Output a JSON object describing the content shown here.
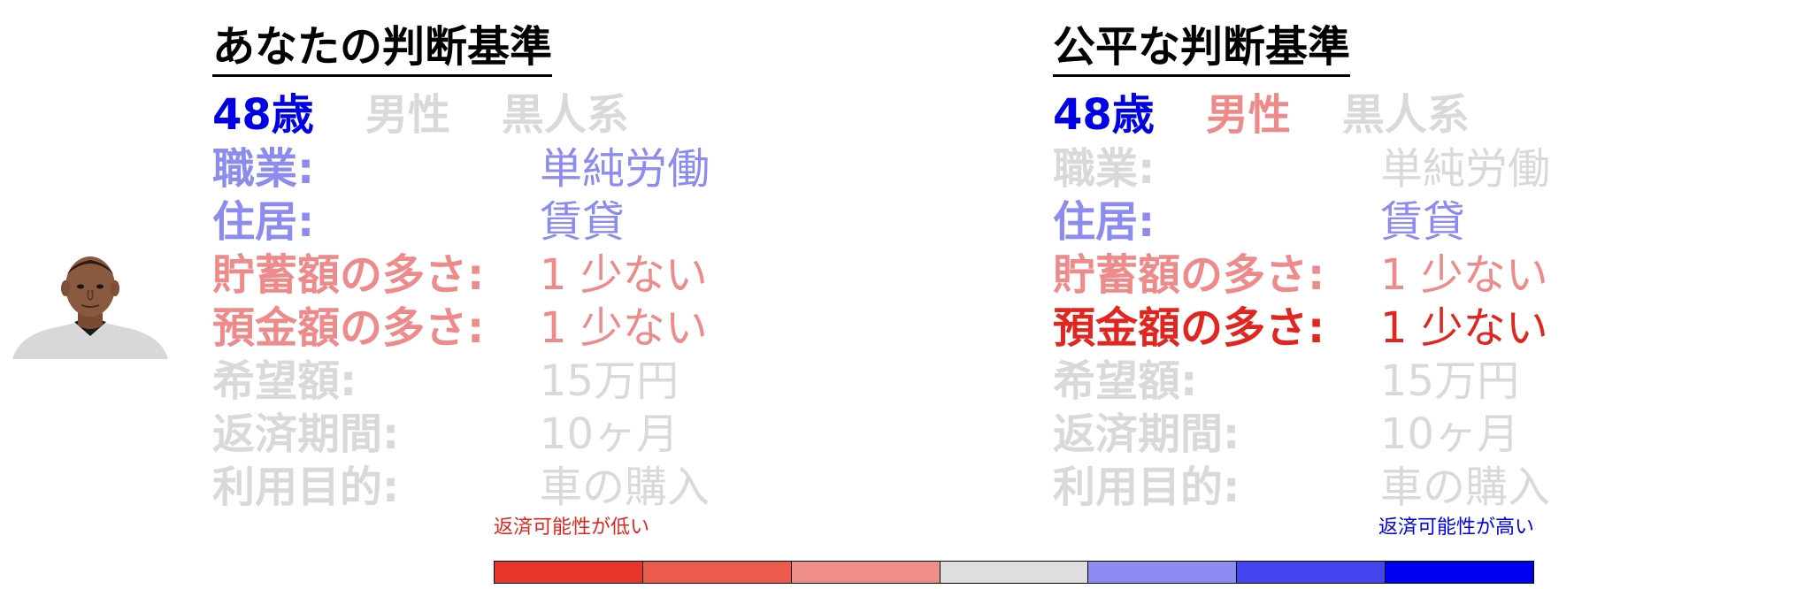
{
  "palette": {
    "grey": "#d9d9d9",
    "lightblue": "#8b8bf0",
    "blue": "#0000e6",
    "lightred": "#ee8a8a",
    "red": "#e0261f"
  },
  "portrait_icon": "person-photo",
  "left_panel": {
    "title": "あなたの判断基準",
    "demographics": [
      {
        "text": "48歳",
        "color": "blue"
      },
      {
        "text": "男性",
        "color": "grey"
      },
      {
        "text": "黒人系",
        "color": "grey"
      }
    ],
    "attributes": [
      {
        "label": "職業:",
        "value": "単純労働",
        "label_color": "lightblue",
        "value_color": "lightblue"
      },
      {
        "label": "住居:",
        "value": "賃貸",
        "label_color": "lightblue",
        "value_color": "lightblue"
      },
      {
        "label": "貯蓄額の多さ:",
        "value": "1 少ない",
        "label_color": "lightred",
        "value_color": "lightred"
      },
      {
        "label": "預金額の多さ:",
        "value": "1 少ない",
        "label_color": "lightred",
        "value_color": "lightred"
      },
      {
        "label": "希望額:",
        "value": "15万円",
        "label_color": "grey",
        "value_color": "grey"
      },
      {
        "label": "返済期間:",
        "value": "10ヶ月",
        "label_color": "grey",
        "value_color": "grey"
      },
      {
        "label": "利用目的:",
        "value": "車の購入",
        "label_color": "grey",
        "value_color": "grey"
      }
    ]
  },
  "right_panel": {
    "title": "公平な判断基準",
    "demographics": [
      {
        "text": "48歳",
        "color": "blue"
      },
      {
        "text": "男性",
        "color": "lightred"
      },
      {
        "text": "黒人系",
        "color": "grey"
      }
    ],
    "attributes": [
      {
        "label": "職業:",
        "value": "単純労働",
        "label_color": "grey",
        "value_color": "grey"
      },
      {
        "label": "住居:",
        "value": "賃貸",
        "label_color": "lightblue",
        "value_color": "lightblue"
      },
      {
        "label": "貯蓄額の多さ:",
        "value": "1 少ない",
        "label_color": "lightred",
        "value_color": "lightred"
      },
      {
        "label": "預金額の多さ:",
        "value": "1 少ない",
        "label_color": "red",
        "value_color": "red"
      },
      {
        "label": "希望額:",
        "value": "15万円",
        "label_color": "grey",
        "value_color": "grey"
      },
      {
        "label": "返済期間:",
        "value": "10ヶ月",
        "label_color": "grey",
        "value_color": "grey"
      },
      {
        "label": "利用目的:",
        "value": "車の購入",
        "label_color": "grey",
        "value_color": "grey"
      }
    ]
  },
  "legend": {
    "low_label": "返済可能性が低い",
    "high_label": "返済可能性が高い",
    "scale_colors": [
      "#e8352b",
      "#ec5a4e",
      "#ef8d89",
      "#dedede",
      "#8b8bf2",
      "#4545f0",
      "#0000f0"
    ]
  }
}
